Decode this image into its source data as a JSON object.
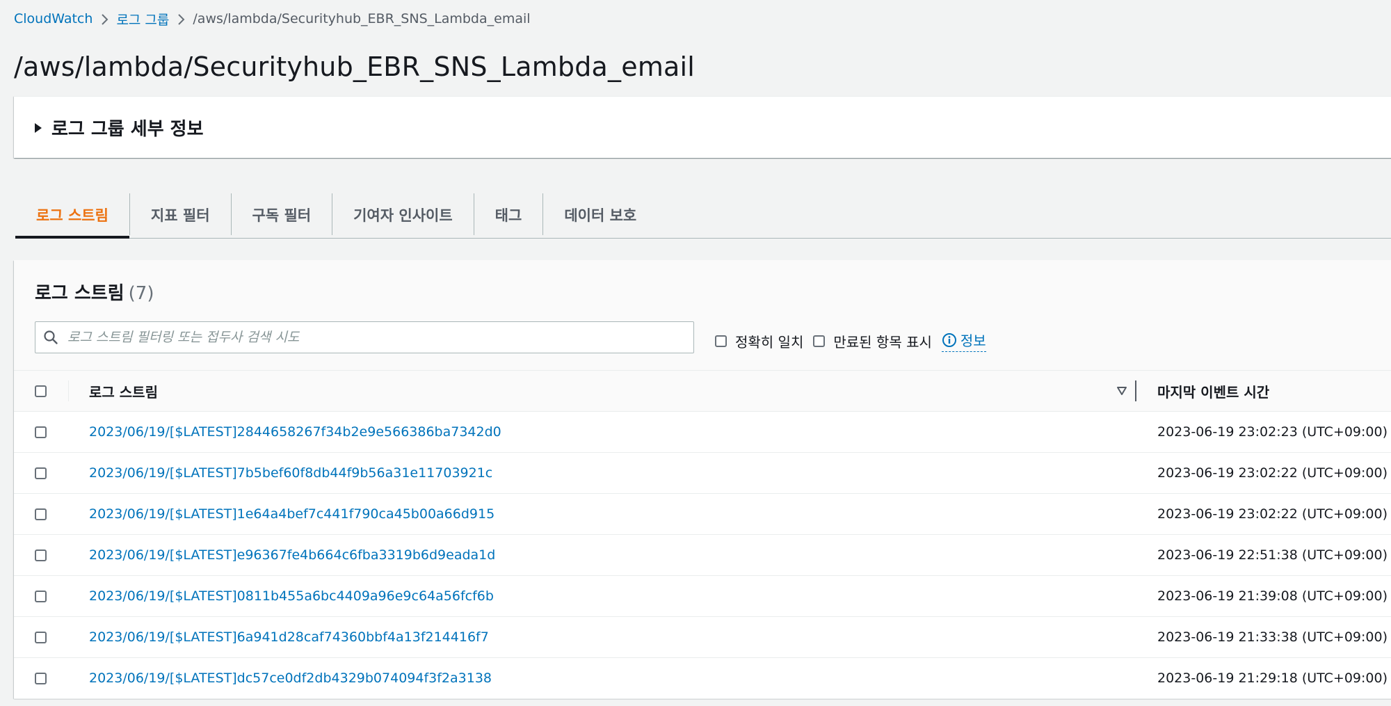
{
  "breadcrumb": {
    "items": [
      "CloudWatch",
      "로그 그룹"
    ],
    "current": "/aws/lambda/Securityhub_EBR_SNS_Lambda_email"
  },
  "page_title": "/aws/lambda/Securityhub_EBR_SNS_Lambda_email",
  "details": {
    "label": "로그 그룹 세부 정보",
    "icon": "caret-right-icon"
  },
  "tabs": [
    {
      "label": "로그 스트림",
      "active": true
    },
    {
      "label": "지표 필터",
      "active": false
    },
    {
      "label": "구독 필터",
      "active": false
    },
    {
      "label": "기여자 인사이트",
      "active": false
    },
    {
      "label": "태그",
      "active": false
    },
    {
      "label": "데이터 보호",
      "active": false
    }
  ],
  "streams_panel": {
    "title": "로그 스트림",
    "count": "(7)",
    "search": {
      "placeholder": "로그 스트림 필터링 또는 접두사 검색 시도",
      "value": ""
    },
    "exact_match_label": "정확히 일치",
    "show_expired_label": "만료된 항목 표시",
    "info_label": "정보"
  },
  "table": {
    "columns": [
      "로그 스트림",
      "마지막 이벤트 시간"
    ],
    "rows": [
      {
        "stream": "2023/06/19/[$LATEST]2844658267f34b2e9e566386ba7342d0",
        "time": "2023-06-19 23:02:23 (UTC+09:00)"
      },
      {
        "stream": "2023/06/19/[$LATEST]7b5bef60f8db44f9b56a31e11703921c",
        "time": "2023-06-19 23:02:22 (UTC+09:00)"
      },
      {
        "stream": "2023/06/19/[$LATEST]1e64a4bef7c441f790ca45b00a66d915",
        "time": "2023-06-19 23:02:22 (UTC+09:00)"
      },
      {
        "stream": "2023/06/19/[$LATEST]e96367fe4b664c6fba3319b6d9eada1d",
        "time": "2023-06-19 22:51:38 (UTC+09:00)"
      },
      {
        "stream": "2023/06/19/[$LATEST]0811b455a6bc4409a96e9c64a56fcf6b",
        "time": "2023-06-19 21:39:08 (UTC+09:00)"
      },
      {
        "stream": "2023/06/19/[$LATEST]6a941d28caf74360bbf4a13f214416f7",
        "time": "2023-06-19 21:33:38 (UTC+09:00)"
      },
      {
        "stream": "2023/06/19/[$LATEST]dc57ce0df2db4329b074094f3f2a3138",
        "time": "2023-06-19 21:29:18 (UTC+09:00)"
      }
    ]
  },
  "colors": {
    "link": "#0073bb",
    "active_tab": "#ec7211",
    "text": "#16191f",
    "background": "#f2f3f3"
  }
}
